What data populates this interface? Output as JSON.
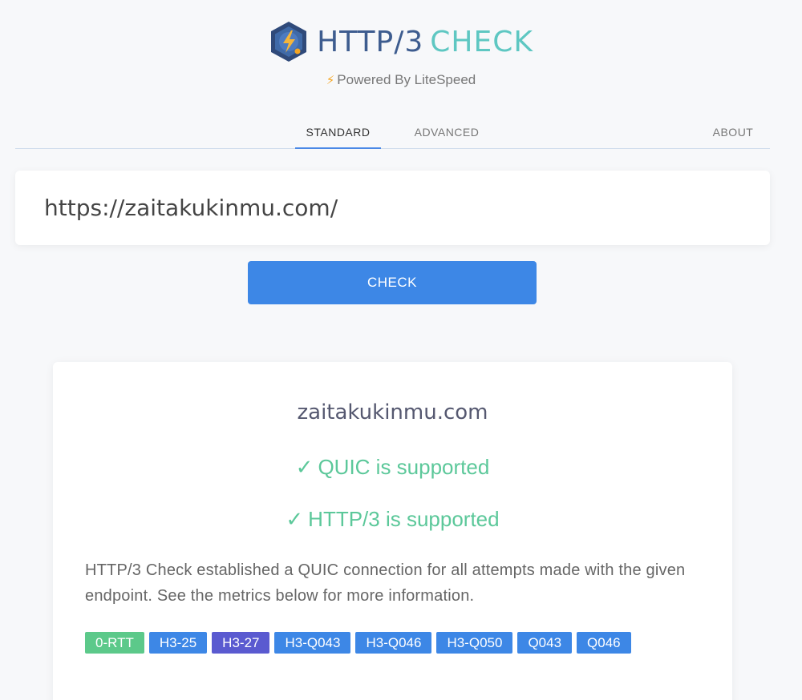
{
  "header": {
    "brand_part1": "HTTP/3",
    "brand_part2": "CHECK",
    "powered_by": "Powered By LiteSpeed",
    "logo_icon": "lightning-hexagon-logo",
    "powered_icon": "lightning-bolt-icon"
  },
  "tabs": [
    {
      "label": "STANDARD",
      "active": true
    },
    {
      "label": "ADVANCED",
      "active": false
    },
    {
      "label": "ABOUT",
      "active": false
    }
  ],
  "url_input": {
    "value": "https://zaitakukinmu.com/"
  },
  "check_button": {
    "label": "CHECK"
  },
  "result": {
    "domain": "zaitakukinmu.com",
    "check_icon": "✓",
    "quic_status": "QUIC is supported",
    "http3_status": "HTTP/3 is supported",
    "description": "HTTP/3 Check established a QUIC connection for all attempts made with the given endpoint. See the metrics below for more information.",
    "badges": [
      {
        "label": "0-RTT",
        "color": "#5cc98a"
      },
      {
        "label": "H3-25",
        "color": "#3d87e6"
      },
      {
        "label": "H3-27",
        "color": "#5a5ad0"
      },
      {
        "label": "H3-Q043",
        "color": "#3d87e6"
      },
      {
        "label": "H3-Q046",
        "color": "#3d87e6"
      },
      {
        "label": "H3-Q050",
        "color": "#3d87e6"
      },
      {
        "label": "Q043",
        "color": "#3d87e6"
      },
      {
        "label": "Q046",
        "color": "#3d87e6"
      }
    ]
  },
  "colors": {
    "accent": "#3d87e6",
    "success": "#5cc89a",
    "brand_dark": "#3d5c8f",
    "brand_teal": "#5ec7c2"
  }
}
